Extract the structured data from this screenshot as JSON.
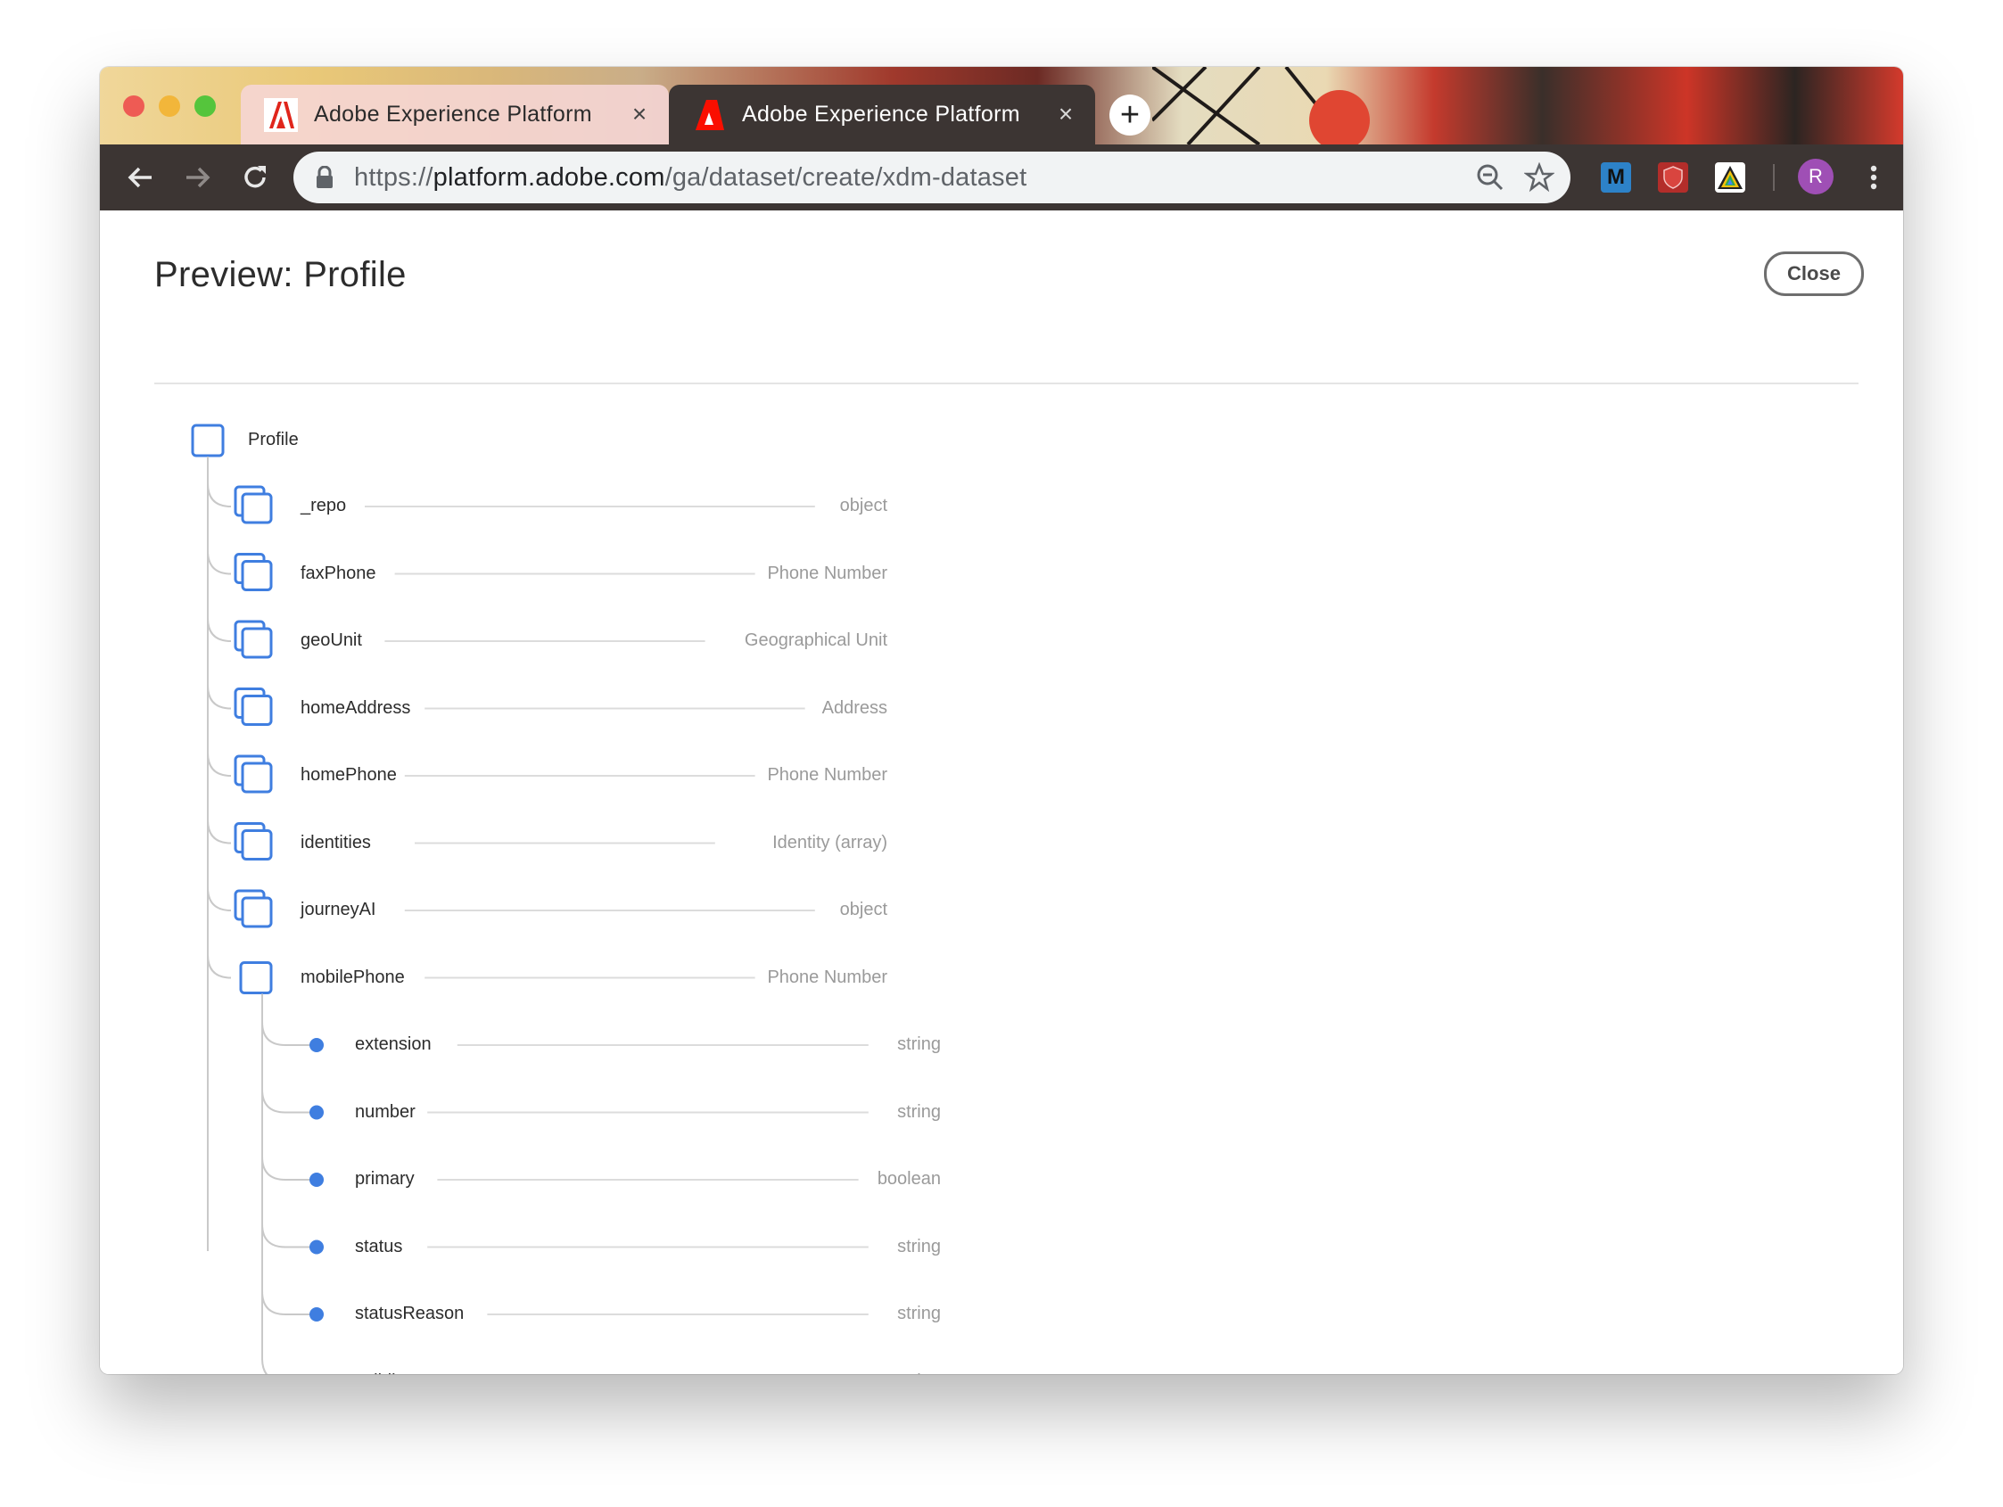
{
  "browser": {
    "tabs": [
      {
        "title": "Adobe Experience Platform",
        "active": false
      },
      {
        "title": "Adobe Experience Platform",
        "active": true
      }
    ],
    "url": {
      "scheme": "https://",
      "host": "platform.adobe.com",
      "path": "/ga/dataset/create/xdm-dataset"
    },
    "extensions": [
      "M"
    ],
    "profile_initial": "R"
  },
  "page": {
    "title": "Preview: Profile",
    "close_label": "Close"
  },
  "tree": {
    "root": {
      "label": "Profile"
    },
    "children": [
      {
        "label": "_repo",
        "type": "object",
        "kind": "object"
      },
      {
        "label": "faxPhone",
        "type": "Phone Number",
        "kind": "object"
      },
      {
        "label": "geoUnit",
        "type": "Geographical Unit",
        "kind": "object"
      },
      {
        "label": "homeAddress",
        "type": "Address",
        "kind": "object"
      },
      {
        "label": "homePhone",
        "type": "Phone Number",
        "kind": "object"
      },
      {
        "label": "identities",
        "type": "Identity (array)",
        "kind": "object"
      },
      {
        "label": "journeyAI",
        "type": "object",
        "kind": "object"
      },
      {
        "label": "mobilePhone",
        "type": "Phone Number",
        "kind": "expanded",
        "children": [
          {
            "label": "extension",
            "type": "string"
          },
          {
            "label": "number",
            "type": "string"
          },
          {
            "label": "primary",
            "type": "boolean"
          },
          {
            "label": "status",
            "type": "string"
          },
          {
            "label": "statusReason",
            "type": "string"
          },
          {
            "label": "validity",
            "type": "string"
          }
        ]
      }
    ]
  },
  "colors": {
    "node_blue": "#3f7ee0",
    "tree_line": "#c9c9c9"
  }
}
